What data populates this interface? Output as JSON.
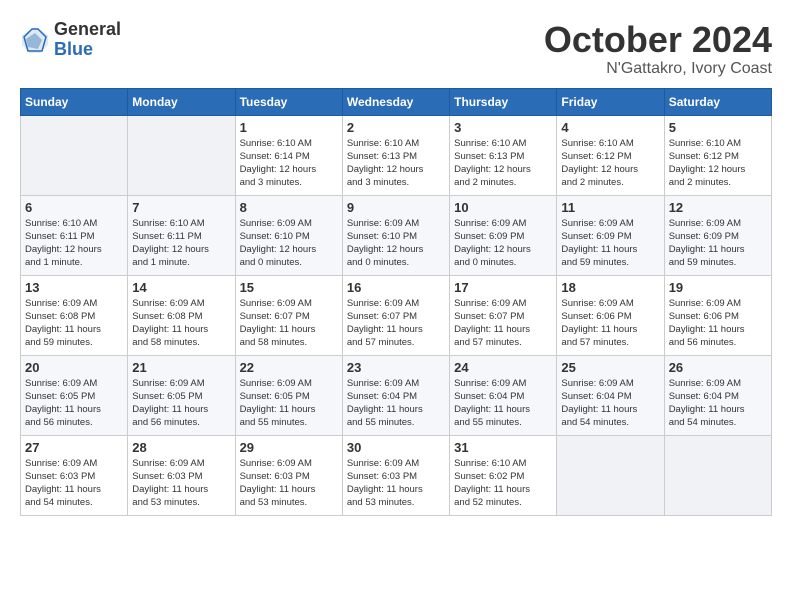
{
  "header": {
    "logo_general": "General",
    "logo_blue": "Blue",
    "month_title": "October 2024",
    "location": "N'Gattakro, Ivory Coast"
  },
  "days_of_week": [
    "Sunday",
    "Monday",
    "Tuesday",
    "Wednesday",
    "Thursday",
    "Friday",
    "Saturday"
  ],
  "weeks": [
    [
      {
        "day": "",
        "info": ""
      },
      {
        "day": "",
        "info": ""
      },
      {
        "day": "1",
        "info": "Sunrise: 6:10 AM\nSunset: 6:14 PM\nDaylight: 12 hours\nand 3 minutes."
      },
      {
        "day": "2",
        "info": "Sunrise: 6:10 AM\nSunset: 6:13 PM\nDaylight: 12 hours\nand 3 minutes."
      },
      {
        "day": "3",
        "info": "Sunrise: 6:10 AM\nSunset: 6:13 PM\nDaylight: 12 hours\nand 2 minutes."
      },
      {
        "day": "4",
        "info": "Sunrise: 6:10 AM\nSunset: 6:12 PM\nDaylight: 12 hours\nand 2 minutes."
      },
      {
        "day": "5",
        "info": "Sunrise: 6:10 AM\nSunset: 6:12 PM\nDaylight: 12 hours\nand 2 minutes."
      }
    ],
    [
      {
        "day": "6",
        "info": "Sunrise: 6:10 AM\nSunset: 6:11 PM\nDaylight: 12 hours\nand 1 minute."
      },
      {
        "day": "7",
        "info": "Sunrise: 6:10 AM\nSunset: 6:11 PM\nDaylight: 12 hours\nand 1 minute."
      },
      {
        "day": "8",
        "info": "Sunrise: 6:09 AM\nSunset: 6:10 PM\nDaylight: 12 hours\nand 0 minutes."
      },
      {
        "day": "9",
        "info": "Sunrise: 6:09 AM\nSunset: 6:10 PM\nDaylight: 12 hours\nand 0 minutes."
      },
      {
        "day": "10",
        "info": "Sunrise: 6:09 AM\nSunset: 6:09 PM\nDaylight: 12 hours\nand 0 minutes."
      },
      {
        "day": "11",
        "info": "Sunrise: 6:09 AM\nSunset: 6:09 PM\nDaylight: 11 hours\nand 59 minutes."
      },
      {
        "day": "12",
        "info": "Sunrise: 6:09 AM\nSunset: 6:09 PM\nDaylight: 11 hours\nand 59 minutes."
      }
    ],
    [
      {
        "day": "13",
        "info": "Sunrise: 6:09 AM\nSunset: 6:08 PM\nDaylight: 11 hours\nand 59 minutes."
      },
      {
        "day": "14",
        "info": "Sunrise: 6:09 AM\nSunset: 6:08 PM\nDaylight: 11 hours\nand 58 minutes."
      },
      {
        "day": "15",
        "info": "Sunrise: 6:09 AM\nSunset: 6:07 PM\nDaylight: 11 hours\nand 58 minutes."
      },
      {
        "day": "16",
        "info": "Sunrise: 6:09 AM\nSunset: 6:07 PM\nDaylight: 11 hours\nand 57 minutes."
      },
      {
        "day": "17",
        "info": "Sunrise: 6:09 AM\nSunset: 6:07 PM\nDaylight: 11 hours\nand 57 minutes."
      },
      {
        "day": "18",
        "info": "Sunrise: 6:09 AM\nSunset: 6:06 PM\nDaylight: 11 hours\nand 57 minutes."
      },
      {
        "day": "19",
        "info": "Sunrise: 6:09 AM\nSunset: 6:06 PM\nDaylight: 11 hours\nand 56 minutes."
      }
    ],
    [
      {
        "day": "20",
        "info": "Sunrise: 6:09 AM\nSunset: 6:05 PM\nDaylight: 11 hours\nand 56 minutes."
      },
      {
        "day": "21",
        "info": "Sunrise: 6:09 AM\nSunset: 6:05 PM\nDaylight: 11 hours\nand 56 minutes."
      },
      {
        "day": "22",
        "info": "Sunrise: 6:09 AM\nSunset: 6:05 PM\nDaylight: 11 hours\nand 55 minutes."
      },
      {
        "day": "23",
        "info": "Sunrise: 6:09 AM\nSunset: 6:04 PM\nDaylight: 11 hours\nand 55 minutes."
      },
      {
        "day": "24",
        "info": "Sunrise: 6:09 AM\nSunset: 6:04 PM\nDaylight: 11 hours\nand 55 minutes."
      },
      {
        "day": "25",
        "info": "Sunrise: 6:09 AM\nSunset: 6:04 PM\nDaylight: 11 hours\nand 54 minutes."
      },
      {
        "day": "26",
        "info": "Sunrise: 6:09 AM\nSunset: 6:04 PM\nDaylight: 11 hours\nand 54 minutes."
      }
    ],
    [
      {
        "day": "27",
        "info": "Sunrise: 6:09 AM\nSunset: 6:03 PM\nDaylight: 11 hours\nand 54 minutes."
      },
      {
        "day": "28",
        "info": "Sunrise: 6:09 AM\nSunset: 6:03 PM\nDaylight: 11 hours\nand 53 minutes."
      },
      {
        "day": "29",
        "info": "Sunrise: 6:09 AM\nSunset: 6:03 PM\nDaylight: 11 hours\nand 53 minutes."
      },
      {
        "day": "30",
        "info": "Sunrise: 6:09 AM\nSunset: 6:03 PM\nDaylight: 11 hours\nand 53 minutes."
      },
      {
        "day": "31",
        "info": "Sunrise: 6:10 AM\nSunset: 6:02 PM\nDaylight: 11 hours\nand 52 minutes."
      },
      {
        "day": "",
        "info": ""
      },
      {
        "day": "",
        "info": ""
      }
    ]
  ]
}
